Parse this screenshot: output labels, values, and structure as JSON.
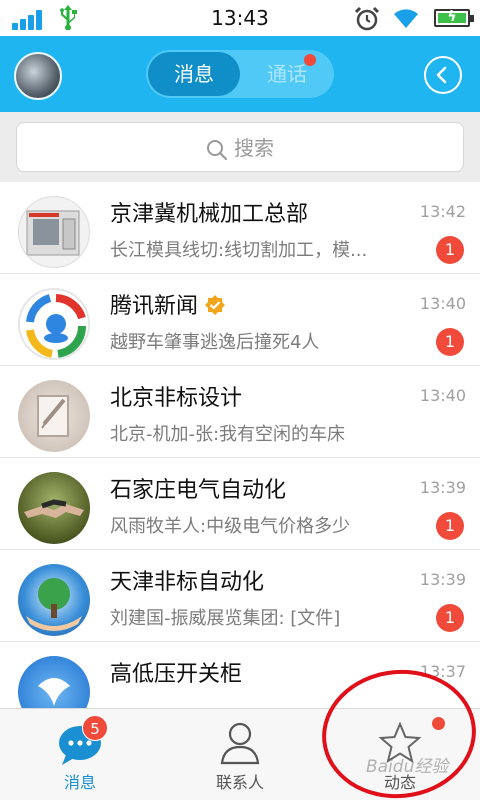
{
  "status_bar": {
    "time": "13:43",
    "icons": [
      "signal-icon",
      "usb-icon",
      "alarm-icon",
      "wifi-icon",
      "battery-charging-icon"
    ]
  },
  "header": {
    "tabs": [
      {
        "label": "消息",
        "active": true
      },
      {
        "label": "通话",
        "active": false,
        "has_dot": true
      }
    ],
    "back_icon": "chevron-left-icon"
  },
  "search": {
    "placeholder": "搜索",
    "icon": "search-icon"
  },
  "conversations": [
    {
      "name": "京津冀机械加工总部",
      "time": "13:42",
      "preview": "长江模具线切:线切割加工，模...",
      "unread": "1",
      "avatar": "machine-avatar"
    },
    {
      "name": "腾讯新闻",
      "time": "13:40",
      "preview": "越野车肇事逃逸后撞死4人",
      "unread": "1",
      "verified": true,
      "avatar": "tencent-news-avatar"
    },
    {
      "name": "北京非标设计",
      "time": "13:40",
      "preview": "北京-机加-张:我有空闲的车床",
      "unread": "",
      "avatar": "design-avatar"
    },
    {
      "name": "石家庄电气自动化",
      "time": "13:39",
      "preview": "风雨牧羊人:中级电气价格多少",
      "unread": "1",
      "avatar": "handshake-avatar"
    },
    {
      "name": "天津非标自动化",
      "time": "13:39",
      "preview": "刘建国-振威展览集团: [文件]",
      "unread": "1",
      "avatar": "globe-tree-avatar"
    },
    {
      "name": "高低压开关柜",
      "time": "13:37",
      "preview": "",
      "unread": "",
      "avatar": "switch-avatar"
    }
  ],
  "tab_bar": {
    "tabs": [
      {
        "label": "消息",
        "badge": "5",
        "active": true,
        "icon": "chat-bubble-icon"
      },
      {
        "label": "联系人",
        "active": false,
        "icon": "contacts-icon"
      },
      {
        "label": "动态",
        "active": false,
        "has_dot": true,
        "icon": "star-icon"
      }
    ]
  },
  "watermark": "Baidu经验",
  "colors": {
    "accent": "#1fb5f0",
    "badge": "#f04a3a",
    "annotation": "#e0101a"
  }
}
